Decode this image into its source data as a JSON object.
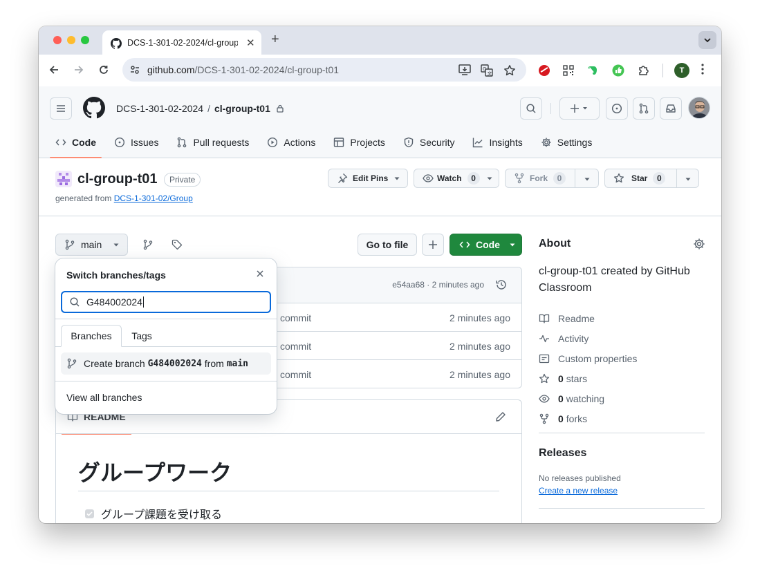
{
  "browser": {
    "tab_title": "DCS-1-301-02-2024/cl-group-t01",
    "url_host": "github.com",
    "url_path": "/DCS-1-301-02-2024/cl-group-t01",
    "profile_initial": "T"
  },
  "header": {
    "owner": "DCS-1-301-02-2024",
    "separator": "/",
    "repo": "cl-group-t01"
  },
  "nav": [
    {
      "label": "Code",
      "icon": "code-icon"
    },
    {
      "label": "Issues",
      "icon": "issue-icon"
    },
    {
      "label": "Pull requests",
      "icon": "pull-request-icon"
    },
    {
      "label": "Actions",
      "icon": "play-icon"
    },
    {
      "label": "Projects",
      "icon": "table-icon"
    },
    {
      "label": "Security",
      "icon": "shield-icon"
    },
    {
      "label": "Insights",
      "icon": "graph-icon"
    },
    {
      "label": "Settings",
      "icon": "gear-icon"
    }
  ],
  "repo": {
    "name": "cl-group-t01",
    "visibility": "Private",
    "generated_prefix": "generated from ",
    "generated_link": "DCS-1-301-02/Group"
  },
  "actions": {
    "edit_pins": "Edit Pins",
    "watch": "Watch",
    "watch_count": "0",
    "fork": "Fork",
    "fork_count": "0",
    "star": "Star",
    "star_count": "0"
  },
  "filebar": {
    "branch": "main",
    "goto_file": "Go to file",
    "code": "Code"
  },
  "files": {
    "commit_info": "e54aa68 · 2 minutes ago",
    "rows": [
      {
        "message": "commit",
        "time": "2 minutes ago"
      },
      {
        "message": "commit",
        "time": "2 minutes ago"
      },
      {
        "message": "commit",
        "time": "2 minutes ago"
      }
    ]
  },
  "readme": {
    "tab": "README",
    "heading": "グループワーク",
    "task1": "グループ課題を受け取る"
  },
  "about": {
    "title": "About",
    "description": "cl-group-t01 created by GitHub Classroom",
    "readme": "Readme",
    "activity": "Activity",
    "custom_properties": "Custom properties",
    "stars_count": "0",
    "stars_label": "stars",
    "watching_count": "0",
    "watching_label": "watching",
    "forks_count": "0",
    "forks_label": "forks"
  },
  "releases": {
    "title": "Releases",
    "none": "No releases published",
    "create": "Create a new release"
  },
  "dropdown": {
    "title": "Switch branches/tags",
    "search_value": "G484002024",
    "tab_branches": "Branches",
    "tab_tags": "Tags",
    "create_prefix": "Create branch",
    "create_branch": "G484002024",
    "create_mid": "from",
    "create_source": "main",
    "view_all": "View all branches"
  },
  "colors": {
    "accent_blue": "#0969da",
    "code_green": "#1f883d",
    "active_underline": "#fd8c73"
  }
}
